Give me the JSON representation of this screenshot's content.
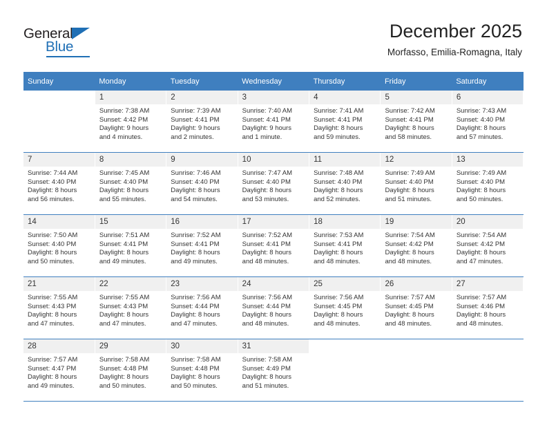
{
  "brand": {
    "name_part1": "General",
    "name_part2": "Blue",
    "accent_color": "#1f6fb5"
  },
  "header": {
    "title": "December 2025",
    "subtitle": "Morfasso, Emilia-Romagna, Italy"
  },
  "calendar": {
    "header_background": "#3f7fbf",
    "weekdays": [
      "Sunday",
      "Monday",
      "Tuesday",
      "Wednesday",
      "Thursday",
      "Friday",
      "Saturday"
    ],
    "weeks": [
      [
        {
          "day": "",
          "sunrise": "",
          "sunset": "",
          "daylight_line1": "",
          "daylight_line2": ""
        },
        {
          "day": "1",
          "sunrise": "Sunrise: 7:38 AM",
          "sunset": "Sunset: 4:42 PM",
          "daylight_line1": "Daylight: 9 hours",
          "daylight_line2": "and 4 minutes."
        },
        {
          "day": "2",
          "sunrise": "Sunrise: 7:39 AM",
          "sunset": "Sunset: 4:41 PM",
          "daylight_line1": "Daylight: 9 hours",
          "daylight_line2": "and 2 minutes."
        },
        {
          "day": "3",
          "sunrise": "Sunrise: 7:40 AM",
          "sunset": "Sunset: 4:41 PM",
          "daylight_line1": "Daylight: 9 hours",
          "daylight_line2": "and 1 minute."
        },
        {
          "day": "4",
          "sunrise": "Sunrise: 7:41 AM",
          "sunset": "Sunset: 4:41 PM",
          "daylight_line1": "Daylight: 8 hours",
          "daylight_line2": "and 59 minutes."
        },
        {
          "day": "5",
          "sunrise": "Sunrise: 7:42 AM",
          "sunset": "Sunset: 4:41 PM",
          "daylight_line1": "Daylight: 8 hours",
          "daylight_line2": "and 58 minutes."
        },
        {
          "day": "6",
          "sunrise": "Sunrise: 7:43 AM",
          "sunset": "Sunset: 4:40 PM",
          "daylight_line1": "Daylight: 8 hours",
          "daylight_line2": "and 57 minutes."
        }
      ],
      [
        {
          "day": "7",
          "sunrise": "Sunrise: 7:44 AM",
          "sunset": "Sunset: 4:40 PM",
          "daylight_line1": "Daylight: 8 hours",
          "daylight_line2": "and 56 minutes."
        },
        {
          "day": "8",
          "sunrise": "Sunrise: 7:45 AM",
          "sunset": "Sunset: 4:40 PM",
          "daylight_line1": "Daylight: 8 hours",
          "daylight_line2": "and 55 minutes."
        },
        {
          "day": "9",
          "sunrise": "Sunrise: 7:46 AM",
          "sunset": "Sunset: 4:40 PM",
          "daylight_line1": "Daylight: 8 hours",
          "daylight_line2": "and 54 minutes."
        },
        {
          "day": "10",
          "sunrise": "Sunrise: 7:47 AM",
          "sunset": "Sunset: 4:40 PM",
          "daylight_line1": "Daylight: 8 hours",
          "daylight_line2": "and 53 minutes."
        },
        {
          "day": "11",
          "sunrise": "Sunrise: 7:48 AM",
          "sunset": "Sunset: 4:40 PM",
          "daylight_line1": "Daylight: 8 hours",
          "daylight_line2": "and 52 minutes."
        },
        {
          "day": "12",
          "sunrise": "Sunrise: 7:49 AM",
          "sunset": "Sunset: 4:40 PM",
          "daylight_line1": "Daylight: 8 hours",
          "daylight_line2": "and 51 minutes."
        },
        {
          "day": "13",
          "sunrise": "Sunrise: 7:49 AM",
          "sunset": "Sunset: 4:40 PM",
          "daylight_line1": "Daylight: 8 hours",
          "daylight_line2": "and 50 minutes."
        }
      ],
      [
        {
          "day": "14",
          "sunrise": "Sunrise: 7:50 AM",
          "sunset": "Sunset: 4:40 PM",
          "daylight_line1": "Daylight: 8 hours",
          "daylight_line2": "and 50 minutes."
        },
        {
          "day": "15",
          "sunrise": "Sunrise: 7:51 AM",
          "sunset": "Sunset: 4:41 PM",
          "daylight_line1": "Daylight: 8 hours",
          "daylight_line2": "and 49 minutes."
        },
        {
          "day": "16",
          "sunrise": "Sunrise: 7:52 AM",
          "sunset": "Sunset: 4:41 PM",
          "daylight_line1": "Daylight: 8 hours",
          "daylight_line2": "and 49 minutes."
        },
        {
          "day": "17",
          "sunrise": "Sunrise: 7:52 AM",
          "sunset": "Sunset: 4:41 PM",
          "daylight_line1": "Daylight: 8 hours",
          "daylight_line2": "and 48 minutes."
        },
        {
          "day": "18",
          "sunrise": "Sunrise: 7:53 AM",
          "sunset": "Sunset: 4:41 PM",
          "daylight_line1": "Daylight: 8 hours",
          "daylight_line2": "and 48 minutes."
        },
        {
          "day": "19",
          "sunrise": "Sunrise: 7:54 AM",
          "sunset": "Sunset: 4:42 PM",
          "daylight_line1": "Daylight: 8 hours",
          "daylight_line2": "and 48 minutes."
        },
        {
          "day": "20",
          "sunrise": "Sunrise: 7:54 AM",
          "sunset": "Sunset: 4:42 PM",
          "daylight_line1": "Daylight: 8 hours",
          "daylight_line2": "and 47 minutes."
        }
      ],
      [
        {
          "day": "21",
          "sunrise": "Sunrise: 7:55 AM",
          "sunset": "Sunset: 4:43 PM",
          "daylight_line1": "Daylight: 8 hours",
          "daylight_line2": "and 47 minutes."
        },
        {
          "day": "22",
          "sunrise": "Sunrise: 7:55 AM",
          "sunset": "Sunset: 4:43 PM",
          "daylight_line1": "Daylight: 8 hours",
          "daylight_line2": "and 47 minutes."
        },
        {
          "day": "23",
          "sunrise": "Sunrise: 7:56 AM",
          "sunset": "Sunset: 4:44 PM",
          "daylight_line1": "Daylight: 8 hours",
          "daylight_line2": "and 47 minutes."
        },
        {
          "day": "24",
          "sunrise": "Sunrise: 7:56 AM",
          "sunset": "Sunset: 4:44 PM",
          "daylight_line1": "Daylight: 8 hours",
          "daylight_line2": "and 48 minutes."
        },
        {
          "day": "25",
          "sunrise": "Sunrise: 7:56 AM",
          "sunset": "Sunset: 4:45 PM",
          "daylight_line1": "Daylight: 8 hours",
          "daylight_line2": "and 48 minutes."
        },
        {
          "day": "26",
          "sunrise": "Sunrise: 7:57 AM",
          "sunset": "Sunset: 4:45 PM",
          "daylight_line1": "Daylight: 8 hours",
          "daylight_line2": "and 48 minutes."
        },
        {
          "day": "27",
          "sunrise": "Sunrise: 7:57 AM",
          "sunset": "Sunset: 4:46 PM",
          "daylight_line1": "Daylight: 8 hours",
          "daylight_line2": "and 48 minutes."
        }
      ],
      [
        {
          "day": "28",
          "sunrise": "Sunrise: 7:57 AM",
          "sunset": "Sunset: 4:47 PM",
          "daylight_line1": "Daylight: 8 hours",
          "daylight_line2": "and 49 minutes."
        },
        {
          "day": "29",
          "sunrise": "Sunrise: 7:58 AM",
          "sunset": "Sunset: 4:48 PM",
          "daylight_line1": "Daylight: 8 hours",
          "daylight_line2": "and 50 minutes."
        },
        {
          "day": "30",
          "sunrise": "Sunrise: 7:58 AM",
          "sunset": "Sunset: 4:48 PM",
          "daylight_line1": "Daylight: 8 hours",
          "daylight_line2": "and 50 minutes."
        },
        {
          "day": "31",
          "sunrise": "Sunrise: 7:58 AM",
          "sunset": "Sunset: 4:49 PM",
          "daylight_line1": "Daylight: 8 hours",
          "daylight_line2": "and 51 minutes."
        },
        {
          "day": "",
          "sunrise": "",
          "sunset": "",
          "daylight_line1": "",
          "daylight_line2": ""
        },
        {
          "day": "",
          "sunrise": "",
          "sunset": "",
          "daylight_line1": "",
          "daylight_line2": ""
        },
        {
          "day": "",
          "sunrise": "",
          "sunset": "",
          "daylight_line1": "",
          "daylight_line2": ""
        }
      ]
    ]
  }
}
